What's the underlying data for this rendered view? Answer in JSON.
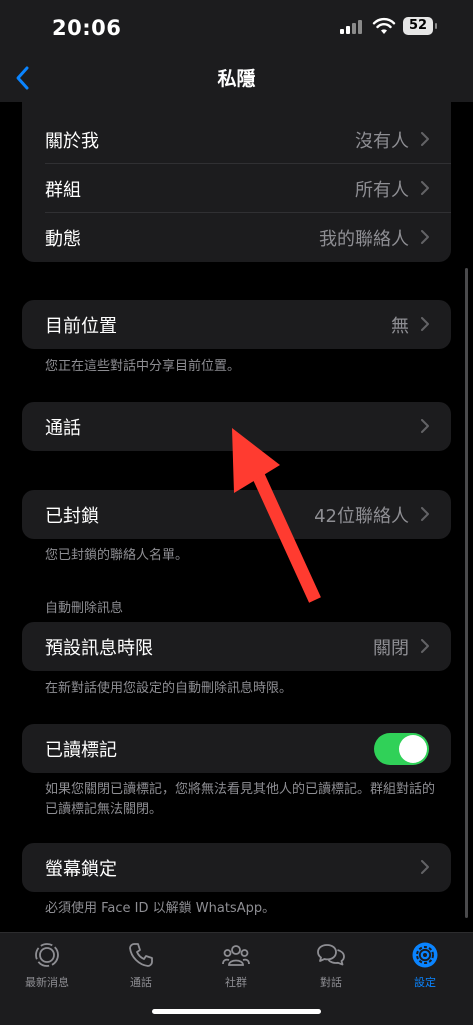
{
  "status": {
    "time": "20:06",
    "battery": "52"
  },
  "nav": {
    "title": "私隱"
  },
  "card1": {
    "rows": [
      {
        "label": "關於我",
        "value": "沒有人"
      },
      {
        "label": "群組",
        "value": "所有人"
      },
      {
        "label": "動態",
        "value": "我的聯絡人"
      }
    ]
  },
  "location": {
    "label": "目前位置",
    "value": "無",
    "footer": "您正在這些對話中分享目前位置。"
  },
  "calls": {
    "label": "通話"
  },
  "blocked": {
    "label": "已封鎖",
    "value": "42位聯絡人",
    "footer": "您已封鎖的聯絡人名單。"
  },
  "disappearing": {
    "header": "自動刪除訊息",
    "label": "預設訊息時限",
    "value": "關閉",
    "footer": "在新對話使用您設定的自動刪除訊息時限。"
  },
  "read_receipts": {
    "label": "已讀標記",
    "enabled": true,
    "footer": "如果您關閉已讀標記，您將無法看見其他人的已讀標記。群組對話的已讀標記無法關閉。"
  },
  "screen_lock": {
    "label": "螢幕鎖定",
    "footer": "必須使用 Face ID 以解鎖 WhatsApp。"
  },
  "tabs": [
    {
      "label": "最新消息",
      "icon": "updates-icon"
    },
    {
      "label": "通話",
      "icon": "phone-icon"
    },
    {
      "label": "社群",
      "icon": "community-icon"
    },
    {
      "label": "對話",
      "icon": "chats-icon"
    },
    {
      "label": "設定",
      "icon": "settings-icon",
      "active": true
    }
  ],
  "colors": {
    "accent": "#0a84ff",
    "toggle_on": "#30d158",
    "arrow": "#ff3b30"
  }
}
